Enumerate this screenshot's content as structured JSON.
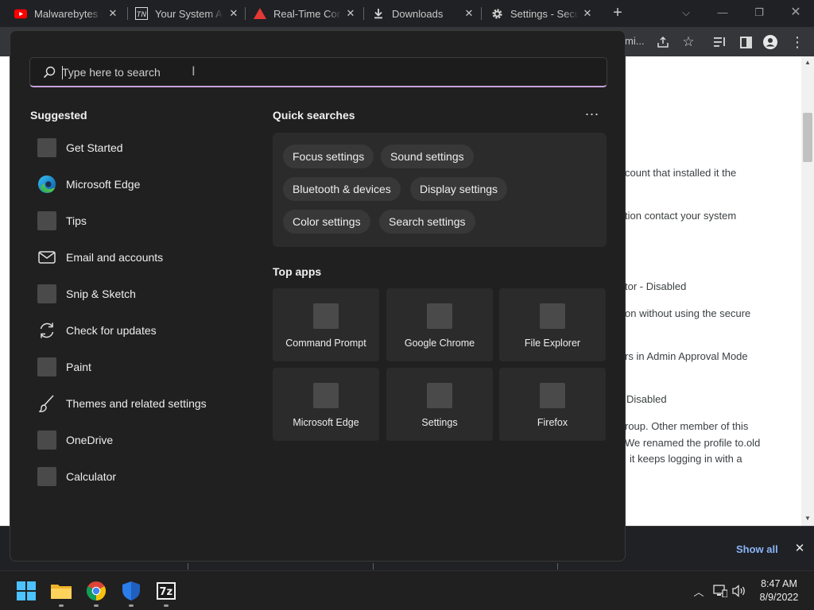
{
  "browser": {
    "tabs": [
      {
        "title": "Malwarebytes s",
        "icon": "youtube-icon"
      },
      {
        "title": "Your System Ad",
        "icon": "tn-icon"
      },
      {
        "title": "Real-Time Corr",
        "icon": "warning-triangle-icon"
      },
      {
        "title": "Downloads",
        "icon": "download-icon"
      },
      {
        "title": "Settings - Secur",
        "icon": "gear-icon"
      }
    ],
    "omnibox_fragment": "mi..."
  },
  "webpage": {
    "lines": [
      "count that installed it the",
      "tion contact your system",
      "tor  - Disabled",
      "on without using the secure",
      "rs in Admin Approval Mode",
      "Disabled",
      "roup. Other member of this",
      "We renamed the profile to.old",
      "it keeps logging in with a"
    ]
  },
  "download_bar": {
    "show_all": "Show all"
  },
  "start_menu": {
    "search": {
      "placeholder": "Type here to search",
      "value": ""
    },
    "suggested": {
      "title": "Suggested",
      "items": [
        {
          "label": "Get Started",
          "icon": "get-started-icon"
        },
        {
          "label": "Microsoft Edge",
          "icon": "edge-icon"
        },
        {
          "label": "Tips",
          "icon": "tips-icon"
        },
        {
          "label": "Email and accounts",
          "icon": "mail-icon"
        },
        {
          "label": "Snip & Sketch",
          "icon": "snip-sketch-icon"
        },
        {
          "label": "Check for updates",
          "icon": "refresh-icon"
        },
        {
          "label": "Paint",
          "icon": "paint-icon"
        },
        {
          "label": "Themes and related settings",
          "icon": "brush-icon"
        },
        {
          "label": "OneDrive",
          "icon": "onedrive-icon"
        },
        {
          "label": "Calculator",
          "icon": "calculator-icon"
        }
      ]
    },
    "quick_searches": {
      "title": "Quick searches",
      "more": "...",
      "chips": [
        "Focus settings",
        "Sound settings",
        "Bluetooth & devices",
        "Display settings",
        "Color settings",
        "Search settings"
      ]
    },
    "top_apps": {
      "title": "Top apps",
      "apps": [
        "Command Prompt",
        "Google Chrome",
        "File Explorer",
        "Microsoft Edge",
        "Settings",
        "Firefox"
      ]
    }
  },
  "taskbar": {
    "apps": [
      "start-icon",
      "file-explorer-icon",
      "chrome-icon",
      "defender-icon",
      "7zip-icon"
    ],
    "sevenzip_label": "7z",
    "time": "8:47 AM",
    "date": "8/9/2022"
  },
  "colors": {
    "accent_underline": "#c8a2d8",
    "start_bg": "#202020",
    "link": "#8ab4f8"
  }
}
